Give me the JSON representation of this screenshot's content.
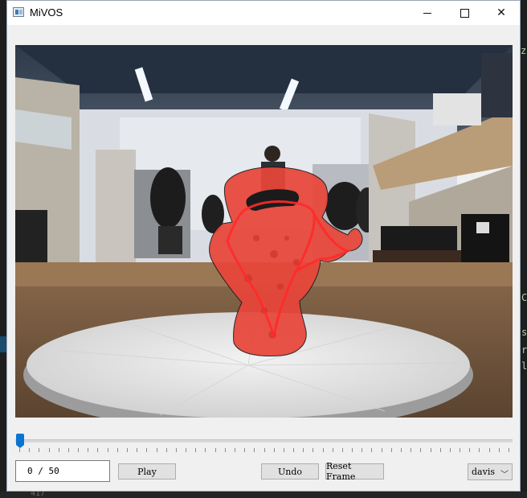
{
  "window": {
    "title": "MiVOS"
  },
  "controls": {
    "frame_counter": "0 /  50",
    "play_label": "Play",
    "undo_label": "Undo",
    "reset_label": "Reset Frame",
    "model_select": "davis"
  },
  "timeline": {
    "current_frame": 0,
    "total_frames": 50
  },
  "background": {
    "side_letters": [
      "z",
      "C",
      "s",
      "r",
      "l"
    ],
    "bottom_text": "417"
  },
  "colors": {
    "mask": "#e8463a",
    "scribble": "#ff2a2a",
    "slider_handle": "#0a74d1"
  }
}
